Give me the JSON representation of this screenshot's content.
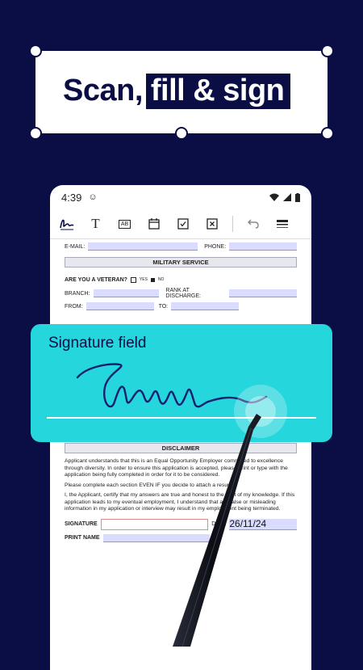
{
  "banner": {
    "part1": "Scan,",
    "part2": "fill & sign"
  },
  "status": {
    "time": "4:39"
  },
  "toolbar": {
    "text_tool": "T",
    "ab_tool": "AB"
  },
  "form": {
    "email_label": "E-MAIL:",
    "phone_label": "PHONE:",
    "military_title": "MILITARY SERVICE",
    "veteran_q": "ARE YOU A VETERAN?",
    "yes": "YES",
    "no": "NO",
    "branch_label": "BRANCH:",
    "rank_label": "RANK AT DISCHARGE:",
    "from_label": "FROM:",
    "to_label": "TO:",
    "disclaimer_title": "DISCLAIMER",
    "para1": "Applicant understands that this is an Equal Opportunity Employer committed to excellence through diversity. In order to ensure this application is accepted, please print or type with the application being fully completed in order for it to be considered.",
    "para2": "Please complete each section EVEN IF you decide to attach a resume.",
    "para3": "I, the Applicant, certify that my answers are true and honest to the best of my knowledge. If this application leads to my eventual employment, I understand that any false or misleading information in my application or interview may result in my employment being terminated.",
    "signature_label": "SIGNATURE",
    "date_label": "DATE",
    "date_value": "26/11/24",
    "print_name_label": "PRINT NAME"
  },
  "signature_card": {
    "title": "Signature field"
  },
  "colors": {
    "navy": "#0b0e45",
    "teal": "#26d6dd",
    "field": "#d9dcff"
  }
}
